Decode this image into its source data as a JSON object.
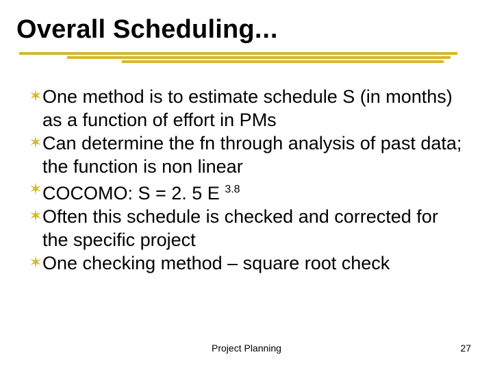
{
  "title": "Overall Scheduling",
  "title_ellipsis": "...",
  "bullet_glyph": "✶",
  "bullets": [
    "One method is to estimate schedule S (in months) as a function of effort in PMs",
    "Can determine the fn through analysis of past data; the function is non linear",
    "COCOMO: S = 2. 5 E ",
    "Often this schedule is checked and corrected for the specific project",
    "One checking method – square root check"
  ],
  "cocomo_exponent": "3.8",
  "footer": {
    "center": "Project Planning",
    "page": "27"
  },
  "colors": {
    "accent": "#d6b82a"
  }
}
